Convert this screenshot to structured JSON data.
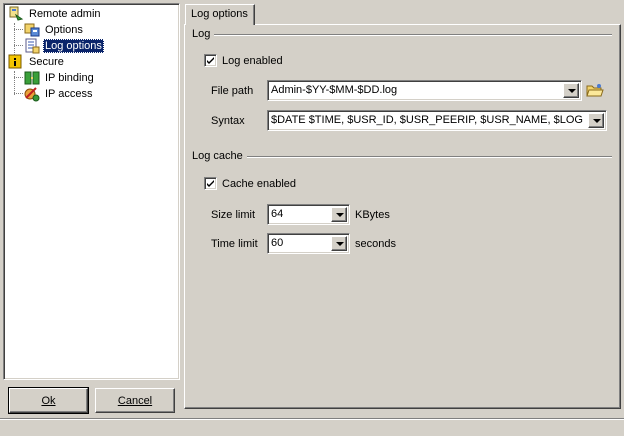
{
  "tree": {
    "items": [
      {
        "label": "Remote admin",
        "icon": "remote-admin-icon"
      },
      {
        "label": "Options",
        "icon": "options-icon"
      },
      {
        "label": "Log options",
        "icon": "log-options-icon",
        "selected": true
      },
      {
        "label": "Secure",
        "icon": "secure-icon"
      },
      {
        "label": "IP binding",
        "icon": "ip-binding-icon"
      },
      {
        "label": "IP access",
        "icon": "ip-access-icon"
      }
    ]
  },
  "buttons": {
    "ok": "Ok",
    "cancel": "Cancel"
  },
  "tab": {
    "label": "Log options"
  },
  "log": {
    "title": "Log",
    "enabled_label": "Log enabled",
    "enabled": true,
    "file_path_label": "File path",
    "file_path_value": "Admin-$YY-$MM-$DD.log",
    "browse_icon": "folder-browse-icon",
    "syntax_label": "Syntax",
    "syntax_value": "$DATE $TIME, $USR_ID, $USR_PEERIP, $USR_NAME, $LOG"
  },
  "cache": {
    "title": "Log cache",
    "enabled_label": "Cache enabled",
    "enabled": true,
    "size_label": "Size limit",
    "size_value": "64",
    "size_unit": "KBytes",
    "time_label": "Time limit",
    "time_value": "60",
    "time_unit": "seconds"
  },
  "colors": {
    "face": "#d4d0c8",
    "selection": "#0a246a",
    "shadow": "#808080"
  }
}
